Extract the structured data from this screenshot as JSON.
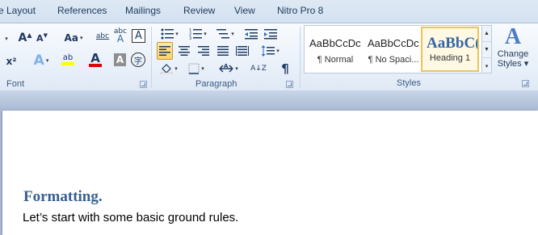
{
  "tabs": [
    "e Layout",
    "References",
    "Mailings",
    "Review",
    "View",
    "Nitro Pro 8"
  ],
  "font_group": {
    "label": "Font",
    "grow_font": "A",
    "shrink_font": "A",
    "change_case": "Aa",
    "clear_formatting_glyph": "abc",
    "phonetic_glyph": "abc",
    "char_border": "A",
    "superscript": "x²",
    "text_effects": "A",
    "highlight_text": "ab",
    "font_color": "A",
    "char_shading": "A",
    "enclose": "字",
    "highlight_color": "#ffff00",
    "font_color_value": "#e00000"
  },
  "paragraph_group": {
    "label": "Paragraph",
    "pilcrow": "¶",
    "sort": "A↓Z"
  },
  "styles_group": {
    "label": "Styles",
    "items": [
      {
        "preview": "AaBbCcDc",
        "name": "¶ Normal"
      },
      {
        "preview": "AaBbCcDc",
        "name": "¶ No Spaci..."
      },
      {
        "preview": "AaBbC(",
        "name": "Heading 1"
      }
    ],
    "change_styles_line1": "Change",
    "change_styles_line2": "Styles ▾",
    "change_styles_glyph": "A"
  },
  "document": {
    "heading": "Formatting.",
    "body": "Let’s start with some basic ground rules."
  }
}
